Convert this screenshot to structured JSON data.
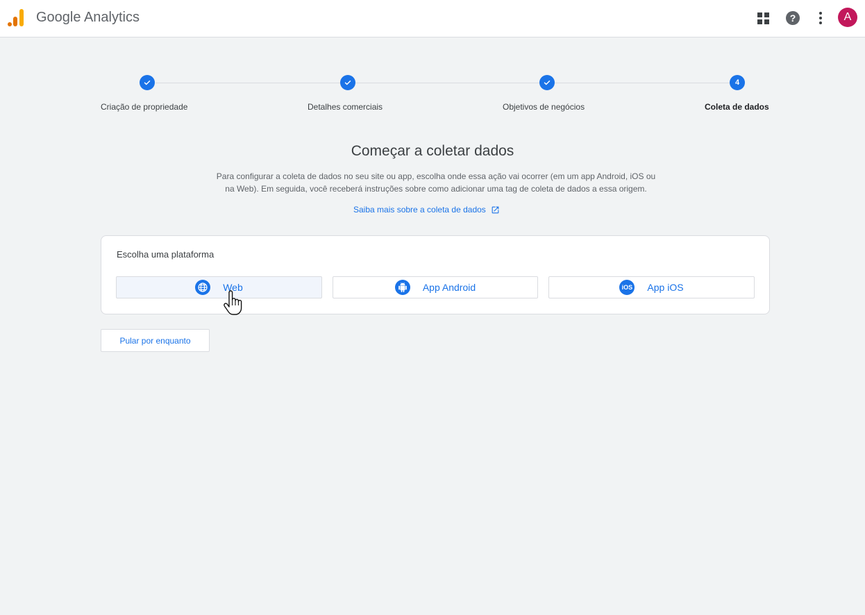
{
  "header": {
    "app_name": "Google Analytics",
    "avatar_letter": "A"
  },
  "steps": [
    {
      "label": "Criação de propriedade",
      "status": "done"
    },
    {
      "label": "Detalhes comerciais",
      "status": "done"
    },
    {
      "label": "Objetivos de negócios",
      "status": "done"
    },
    {
      "label": "Coleta de dados",
      "status": "current",
      "number": "4"
    }
  ],
  "main": {
    "heading": "Começar a coletar dados",
    "description_line1": "Para configurar a coleta de dados no seu site ou app, escolha onde essa ação vai ocorrer (em um app Android, iOS ou",
    "description_line2": "na Web). Em seguida, você receberá instruções sobre como adicionar uma tag de coleta de dados a essa origem.",
    "learn_more": "Saiba mais sobre a coleta de dados"
  },
  "platform_card": {
    "title": "Escolha uma plataforma",
    "options": [
      {
        "label": "Web",
        "icon": "globe-icon"
      },
      {
        "label": "App Android",
        "icon": "android-icon"
      },
      {
        "label": "App iOS",
        "icon": "ios-icon",
        "icon_text": "iOS"
      }
    ]
  },
  "skip_label": "Pular por enquanto",
  "colors": {
    "primary": "#1a73e8",
    "background": "#f1f3f4",
    "avatar": "#c2185b",
    "logo_dark": "#e37400",
    "logo_light": "#f9ab00"
  }
}
